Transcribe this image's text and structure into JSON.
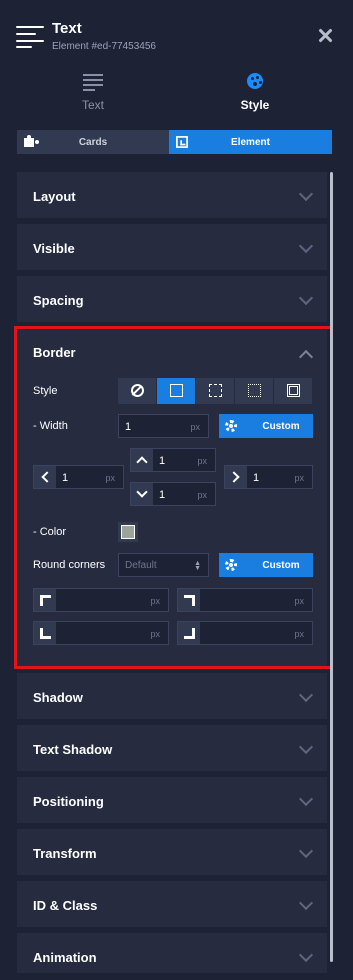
{
  "header": {
    "title": "Text",
    "subtitle": "Element #ed-77453456"
  },
  "tabs": [
    {
      "label": "Text"
    },
    {
      "label": "Style"
    }
  ],
  "toggle": {
    "cards_label": "Cards",
    "element_label": "Element"
  },
  "sections_above": [
    {
      "label": "Layout"
    },
    {
      "label": "Visible"
    },
    {
      "label": "Spacing"
    }
  ],
  "border": {
    "title": "Border",
    "style_label": "Style",
    "style_options": [
      "none",
      "solid",
      "dashed",
      "dotted",
      "double"
    ],
    "style_selected": "solid",
    "width_label": "- Width",
    "width_value": "1",
    "unit": "px",
    "custom_label": "Custom",
    "sides": {
      "left": "1",
      "top": "1",
      "bottom": "1",
      "right": "1"
    },
    "color_label": "- Color",
    "color_value": "#9aa49a",
    "round_label": "Round corners",
    "round_placeholder": "Default",
    "round_custom_label": "Custom",
    "corners": {
      "top_left": "",
      "top_right": "",
      "bottom_left": "",
      "bottom_right": ""
    }
  },
  "sections_below": [
    {
      "label": "Shadow"
    },
    {
      "label": "Text Shadow"
    },
    {
      "label": "Positioning"
    },
    {
      "label": "Transform"
    },
    {
      "label": "ID & Class"
    },
    {
      "label": "Animation"
    }
  ],
  "colors": {
    "accent": "#1a7de0",
    "panel": "#262b40",
    "background": "#1e2235",
    "highlight": "#e0151b"
  }
}
